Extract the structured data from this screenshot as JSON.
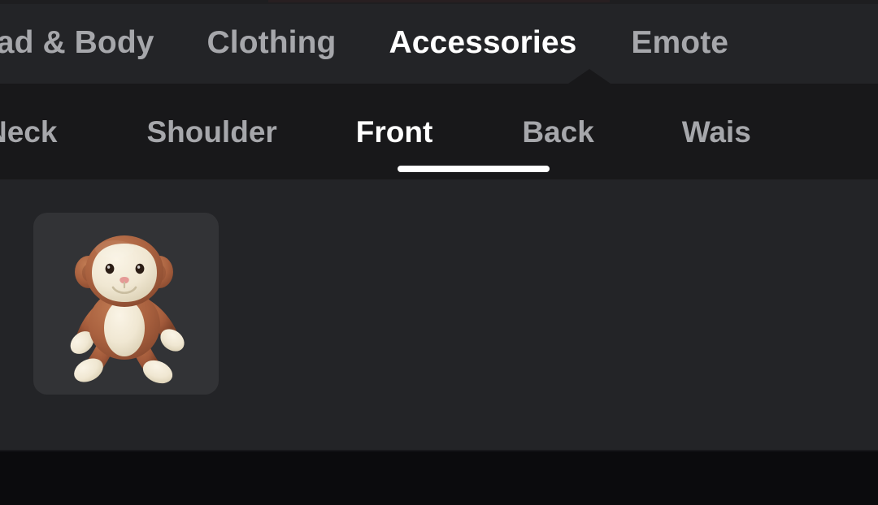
{
  "screen": {
    "name": "avatar-editor-catalog",
    "background_color": "#232427",
    "subnav_background_color": "#18181a",
    "card_background_color": "#323336",
    "accent_color": "#ffffff",
    "inactive_text_color": "#a6a7ab",
    "bottom_bar_color": "#0b0b0d"
  },
  "category_tabs": {
    "name": "primary-category-tabs",
    "active": "Accessories",
    "items": [
      {
        "label": "ead & Body",
        "full_label": "Head & Body",
        "active": false,
        "clipped": "left"
      },
      {
        "label": "Clothing",
        "full_label": "Clothing",
        "active": false,
        "clipped": "none"
      },
      {
        "label": "Accessories",
        "full_label": "Accessories",
        "active": true,
        "clipped": "none"
      },
      {
        "label": "Emote",
        "full_label": "Emotes",
        "active": false,
        "clipped": "right"
      }
    ]
  },
  "sub_tabs": {
    "name": "accessory-subcategory-tabs",
    "active": "Front",
    "items": [
      {
        "label": "Neck",
        "full_label": "Neck",
        "active": false,
        "clipped": "left"
      },
      {
        "label": "Shoulder",
        "full_label": "Shoulder",
        "active": false,
        "clipped": "none"
      },
      {
        "label": "Front",
        "full_label": "Front",
        "active": true,
        "clipped": "none"
      },
      {
        "label": "Back",
        "full_label": "Back",
        "active": false,
        "clipped": "none"
      },
      {
        "label": "Wais",
        "full_label": "Waist",
        "active": false,
        "clipped": "right"
      }
    ]
  },
  "item_grid": {
    "name": "accessory-item-grid",
    "count": 1,
    "items": [
      {
        "name": "monkey-plush-accessory",
        "icon": "monkey-plush-icon",
        "selected": false,
        "colors": {
          "fur": "#a9613f",
          "fur_light": "#c07a52",
          "fur_dark": "#8a4b30",
          "cream": "#f2ead6",
          "cream_shade": "#ddd2b7",
          "eye": "#2b1d15",
          "nose": "#e59a96"
        }
      }
    ]
  },
  "bottom_bar": {
    "name": "bottom-safe-area",
    "label": ""
  }
}
